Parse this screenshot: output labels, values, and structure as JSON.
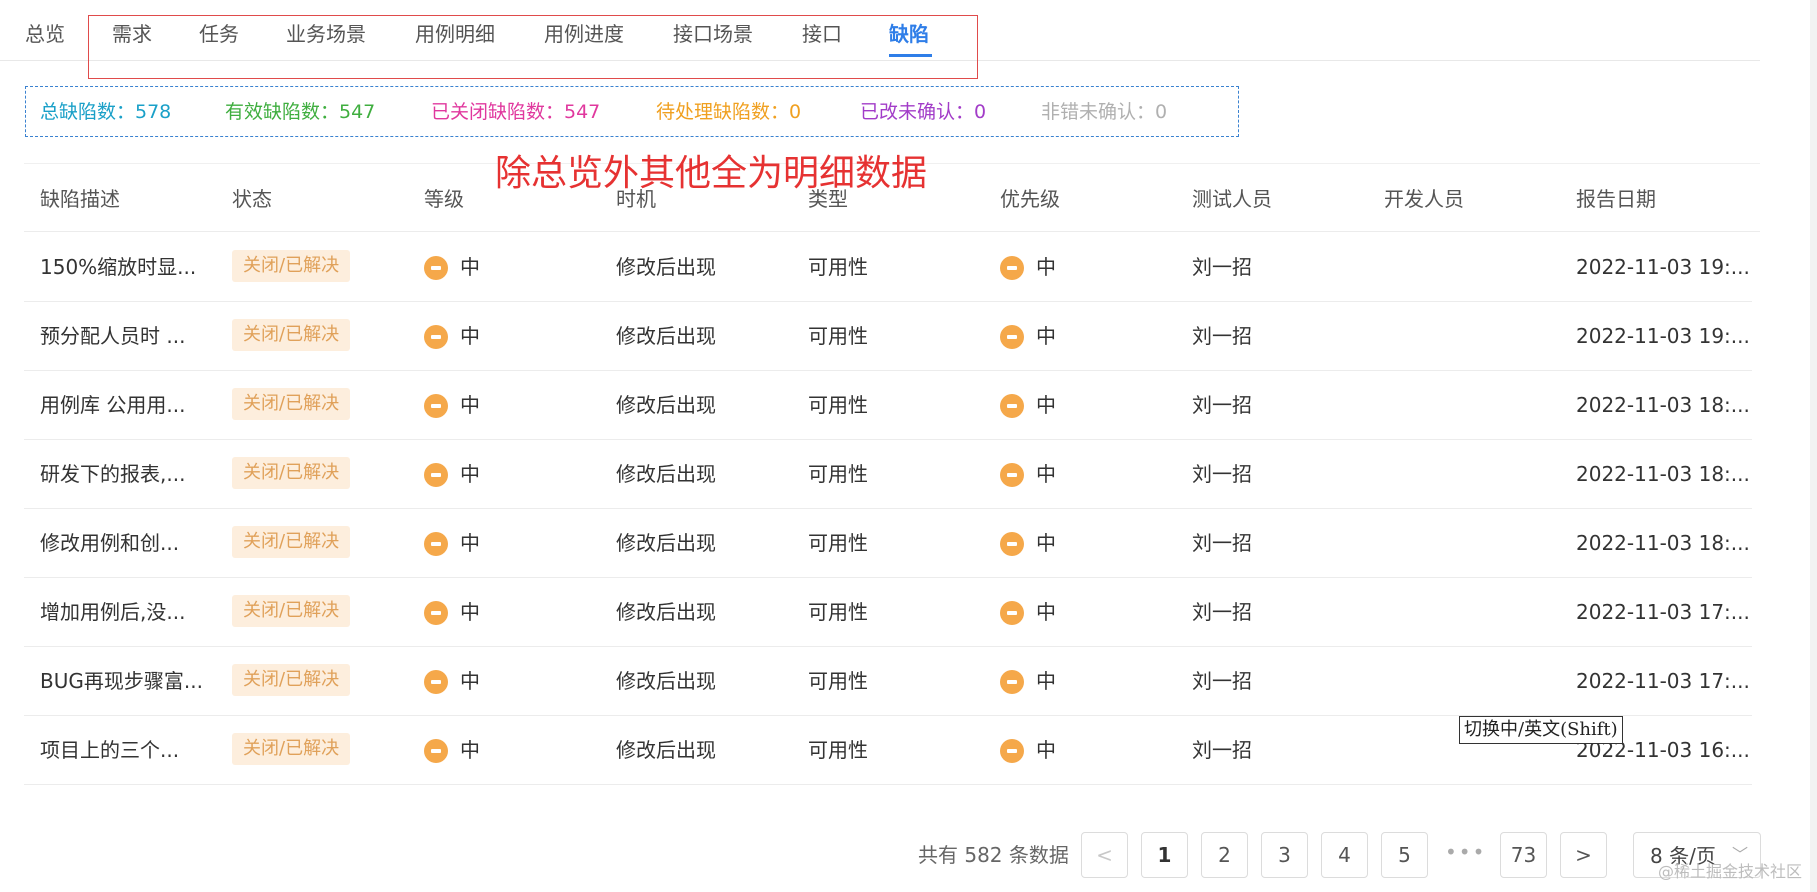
{
  "tabs": [
    "总览",
    "需求",
    "任务",
    "业务场景",
    "用例明细",
    "用例进度",
    "接口场景",
    "接口",
    "缺陷"
  ],
  "active_tab": "缺陷",
  "stats": [
    {
      "label": "总缺陷数：578",
      "color": "#1aa0c8"
    },
    {
      "label": "有效缺陷数：547",
      "color": "#3fae3f"
    },
    {
      "label": "已关闭缺陷数：547",
      "color": "#e0389e"
    },
    {
      "label": "待处理缺陷数：0",
      "color": "#f0a020"
    },
    {
      "label": "已改未确认：0",
      "color": "#a23cc8"
    },
    {
      "label": "非错未确认：0",
      "color": "#b0b0b0"
    }
  ],
  "annotation": "除总览外其他全为明细数据",
  "table": {
    "columns": [
      "缺陷描述",
      "状态",
      "等级",
      "时机",
      "类型",
      "优先级",
      "测试人员",
      "开发人员",
      "报告日期"
    ],
    "rows": [
      {
        "desc": "150%缩放时显...",
        "status": "关闭/已解决",
        "level": "中",
        "timing": "修改后出现",
        "type": "可用性",
        "priority": "中",
        "tester": "刘一招",
        "developer": "",
        "date": "2022-11-03 19:..."
      },
      {
        "desc": "预分配人员时 ...",
        "status": "关闭/已解决",
        "level": "中",
        "timing": "修改后出现",
        "type": "可用性",
        "priority": "中",
        "tester": "刘一招",
        "developer": "",
        "date": "2022-11-03 19:..."
      },
      {
        "desc": "用例库 公用用...",
        "status": "关闭/已解决",
        "level": "中",
        "timing": "修改后出现",
        "type": "可用性",
        "priority": "中",
        "tester": "刘一招",
        "developer": "",
        "date": "2022-11-03 18:..."
      },
      {
        "desc": "研发下的报表,...",
        "status": "关闭/已解决",
        "level": "中",
        "timing": "修改后出现",
        "type": "可用性",
        "priority": "中",
        "tester": "刘一招",
        "developer": "",
        "date": "2022-11-03 18:..."
      },
      {
        "desc": "修改用例和创...",
        "status": "关闭/已解决",
        "level": "中",
        "timing": "修改后出现",
        "type": "可用性",
        "priority": "中",
        "tester": "刘一招",
        "developer": "",
        "date": "2022-11-03 18:..."
      },
      {
        "desc": "增加用例后,没...",
        "status": "关闭/已解决",
        "level": "中",
        "timing": "修改后出现",
        "type": "可用性",
        "priority": "中",
        "tester": "刘一招",
        "developer": "",
        "date": "2022-11-03 17:..."
      },
      {
        "desc": "BUG再现步骤富...",
        "status": "关闭/已解决",
        "level": "中",
        "timing": "修改后出现",
        "type": "可用性",
        "priority": "中",
        "tester": "刘一招",
        "developer": "",
        "date": "2022-11-03 17:..."
      },
      {
        "desc": "项目上的三个...",
        "status": "关闭/已解决",
        "level": "中",
        "timing": "修改后出现",
        "type": "可用性",
        "priority": "中",
        "tester": "刘一招",
        "developer": "",
        "date": "2022-11-03 16:..."
      }
    ]
  },
  "pagination": {
    "total_text": "共有 582 条数据",
    "prev": "<",
    "pages": [
      "1",
      "2",
      "3",
      "4",
      "5"
    ],
    "current_page": "1",
    "ellipsis": "•••",
    "last_page": "73",
    "next": ">",
    "page_size": "8 条/页",
    "chevron": "﹀"
  },
  "ime_tooltip": "切换中/英文(Shift)",
  "watermark": "@稀土掘金技术社区",
  "icons": {
    "level_icon": "minus-circle-icon",
    "level_icon_color": "#f5a84a"
  }
}
